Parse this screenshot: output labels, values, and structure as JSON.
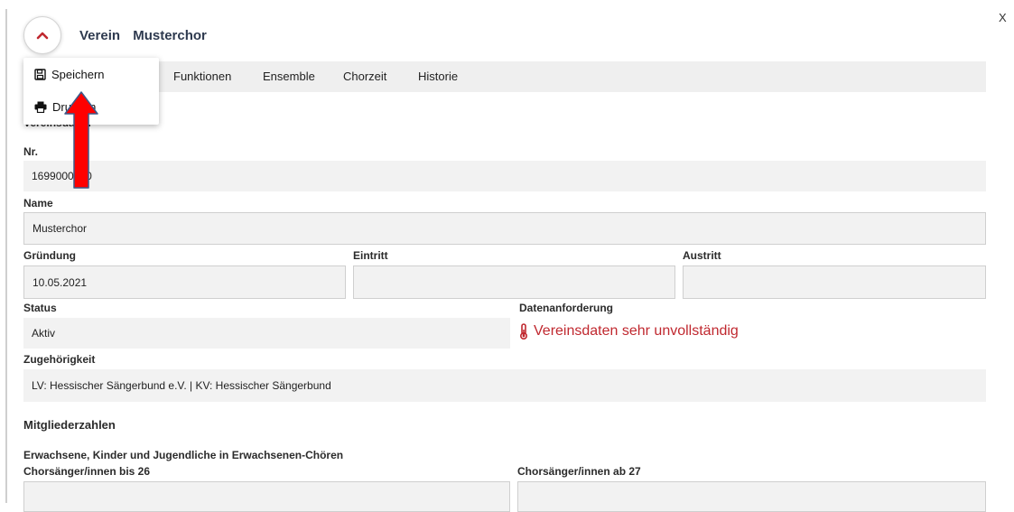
{
  "window": {
    "close_label": "X"
  },
  "header": {
    "collapse_icon": "chevron-up-icon",
    "title_prefix": "Verein",
    "title_name": "Musterchor"
  },
  "tabs": [
    {
      "label": "Funktionen"
    },
    {
      "label": "Ensemble"
    },
    {
      "label": "Chorzeit"
    },
    {
      "label": "Historie"
    }
  ],
  "menu": {
    "items": [
      {
        "label": "Speichern",
        "icon": "save-icon"
      },
      {
        "label": "Drucken",
        "icon": "print-icon"
      }
    ]
  },
  "form": {
    "section_vereinsdaten": "Vereinsdaten",
    "nr": {
      "label": "Nr.",
      "value": "1699000000"
    },
    "name": {
      "label": "Name",
      "value": "Musterchor"
    },
    "gruendung": {
      "label": "Gründung",
      "value": "10.05.2021"
    },
    "eintritt": {
      "label": "Eintritt",
      "value": ""
    },
    "austritt": {
      "label": "Austritt",
      "value": ""
    },
    "status": {
      "label": "Status",
      "value": "Aktiv"
    },
    "datenanforderung": {
      "label": "Datenanforderung",
      "value": "Vereinsdaten sehr unvollständig",
      "icon": "thermometer-icon"
    },
    "zugehoerigkeit": {
      "label": "Zugehörigkeit",
      "value": "LV: Hessischer Sängerbund e.V. | KV: Hessischer Sängerbund"
    },
    "section_mitglieder": "Mitgliederzahlen",
    "subsection_erwachsene": "Erwachsene, Kinder und Jugendliche in Erwachsenen-Chören",
    "saenger_bis_26": {
      "label": "Chorsänger/innen bis 26",
      "value": ""
    },
    "saenger_ab_27": {
      "label": "Chorsänger/innen ab 27",
      "value": ""
    }
  },
  "colors": {
    "warning": "#c0282f",
    "chevron": "#c0282f",
    "arrow": "#ff0000",
    "field_bg": "#f2f2f2"
  }
}
